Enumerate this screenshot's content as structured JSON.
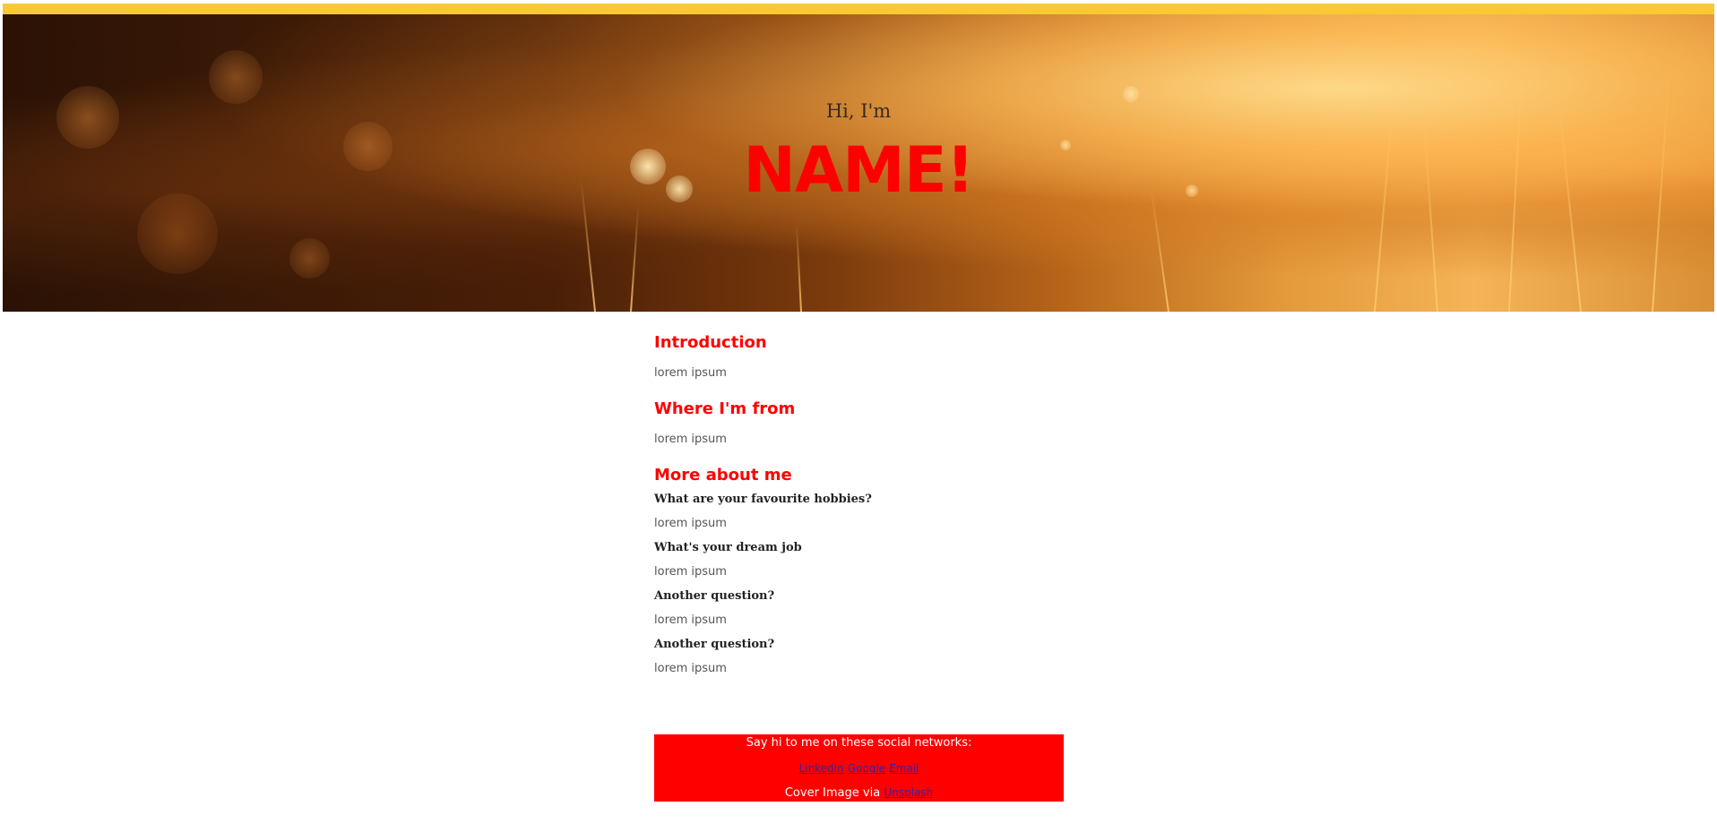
{
  "hero": {
    "greeting": "Hi, I'm",
    "name": "NAME!"
  },
  "sections": {
    "introduction": {
      "title": "Introduction",
      "text": "lorem ipsum"
    },
    "where_from": {
      "title": "Where I'm from",
      "text": "lorem ipsum"
    },
    "more_about": {
      "title": "More about me",
      "questions": [
        {
          "q": "What are your favourite hobbies?",
          "a": "lorem ipsum"
        },
        {
          "q": "What's your dream job",
          "a": "lorem ipsum"
        },
        {
          "q": "Another question?",
          "a": "lorem ipsum"
        },
        {
          "q": "Another question?",
          "a": "lorem ipsum"
        }
      ]
    }
  },
  "footer": {
    "social_text": "Say hi to me on these social networks:",
    "links": [
      "Linkedin",
      "Google",
      "Email"
    ],
    "cover_text": "Cover Image via",
    "cover_link": "Unsplash"
  },
  "colors": {
    "accent": "#ff0000",
    "topbar": "#f9c935"
  }
}
